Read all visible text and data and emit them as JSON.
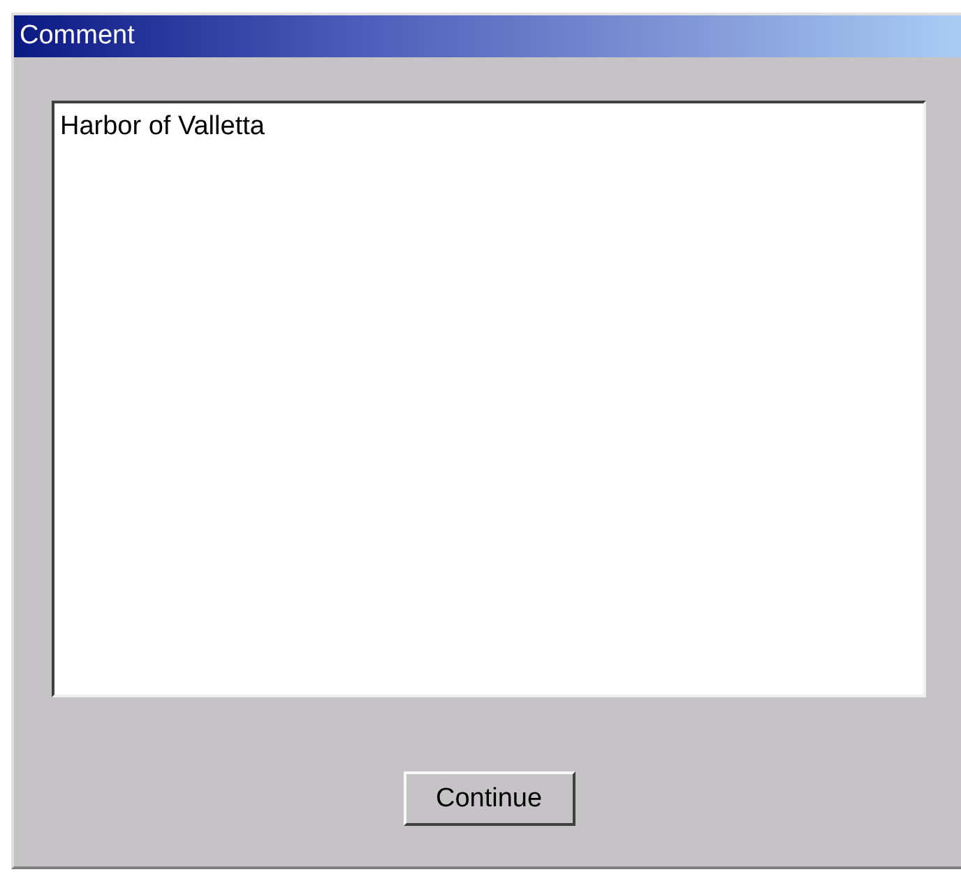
{
  "window": {
    "title": "Comment"
  },
  "comment_field": {
    "value": "Harbor of Valletta"
  },
  "buttons": [
    "Continue"
  ]
}
